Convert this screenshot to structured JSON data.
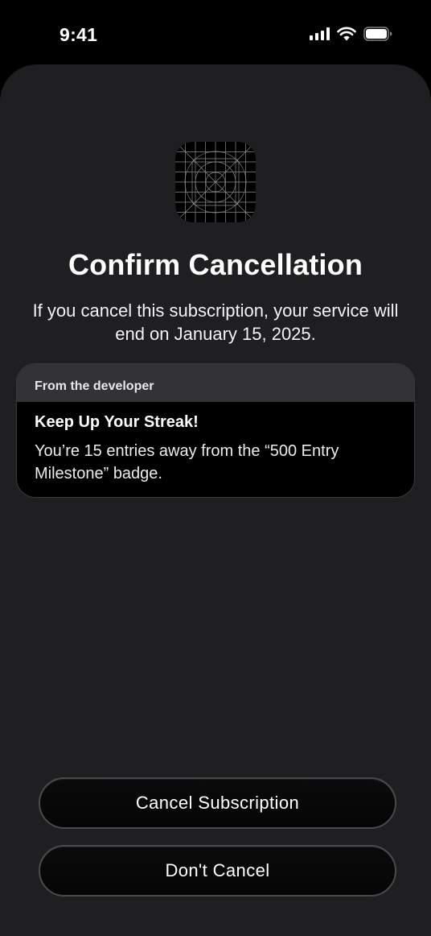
{
  "status_bar": {
    "time": "9:41",
    "icons": [
      "signal-icon",
      "wifi-icon",
      "battery-icon"
    ]
  },
  "app": {
    "icon": "app-icon-grid"
  },
  "header": {
    "title": "Confirm Cancellation",
    "subtitle": "If you cancel this subscription, your service will end on January 15, 2025."
  },
  "developer_card": {
    "header": "From the developer",
    "title": "Keep Up Your Streak!",
    "text": "You’re 15 entries away from the “500 Entry Milestone” badge."
  },
  "actions": {
    "cancel_subscription_label": "Cancel Subscription",
    "dont_cancel_label": "Don't Cancel"
  },
  "colors": {
    "background": "#000000",
    "sheet": "#1f1f21",
    "card_header": "#333335",
    "text": "#ffffff"
  }
}
